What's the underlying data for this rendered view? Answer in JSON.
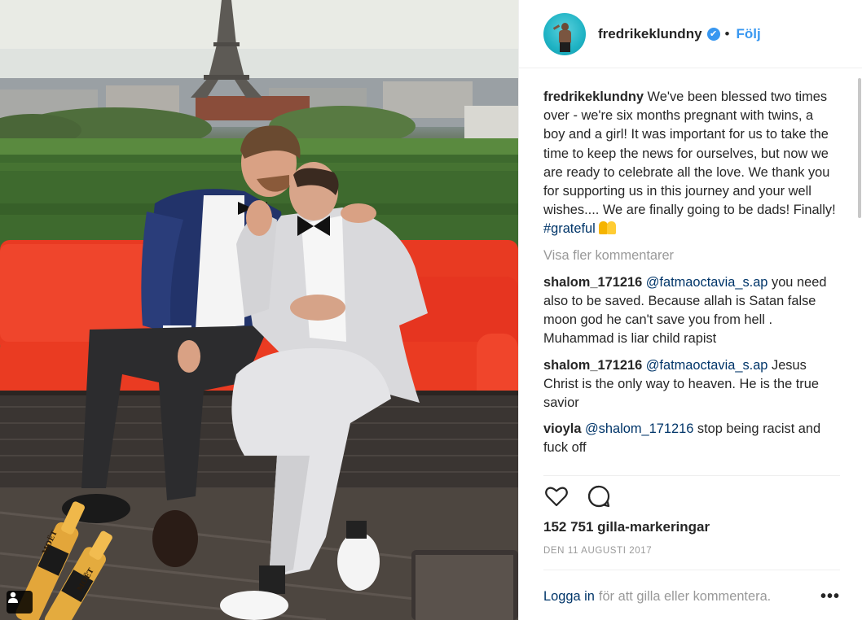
{
  "post": {
    "username": "fredrikeklundny",
    "verified_symbol": "✔",
    "separator": "•",
    "follow_label": "Följ"
  },
  "photo": {
    "description": "",
    "bottle_label_1": "MOËT",
    "bottle_label_2": "MOËT"
  },
  "caption": {
    "user": "fredrikeklundny",
    "text": "We've been blessed two times over - we're six months pregnant with twins, a boy and a girl! It was important for us to take the time to keep the news for ourselves, but now we are ready to celebrate all the love. We thank you for supporting us in this journey and your well wishes.... We are finally going to be dads! Finally!",
    "hashtag": "#grateful"
  },
  "show_more_comments": "Visa fler kommentarer",
  "comments": [
    {
      "user": "shalom_171216",
      "mention": "@fatmaoctavia_s.ap",
      "text": "you need also to be saved. Because allah is Satan false moon god he can't save you from hell . Muhammad is liar child rapist"
    },
    {
      "user": "shalom_171216",
      "mention": "@fatmaoctavia_s.ap",
      "text": "Jesus Christ is the only way to heaven. He is the true savior"
    },
    {
      "user": "vioyla",
      "mention": "@shalom_171216",
      "text": "stop being racist and fuck off"
    }
  ],
  "likes": "152 751 gilla-markeringar",
  "date": "DEN 11 AUGUSTI 2017",
  "footer": {
    "login_link": "Logga in",
    "login_text": "för att gilla eller kommentera.",
    "more_label": "•••"
  },
  "icons": {
    "like": "heart-icon",
    "comment": "comment-bubble-icon",
    "tag": "person-tag-icon",
    "verified": "verified-badge-icon"
  },
  "colors": {
    "accent": "#3897f0",
    "link": "#003569",
    "muted": "#999999",
    "text": "#262626",
    "sofa": "#e8361f"
  }
}
